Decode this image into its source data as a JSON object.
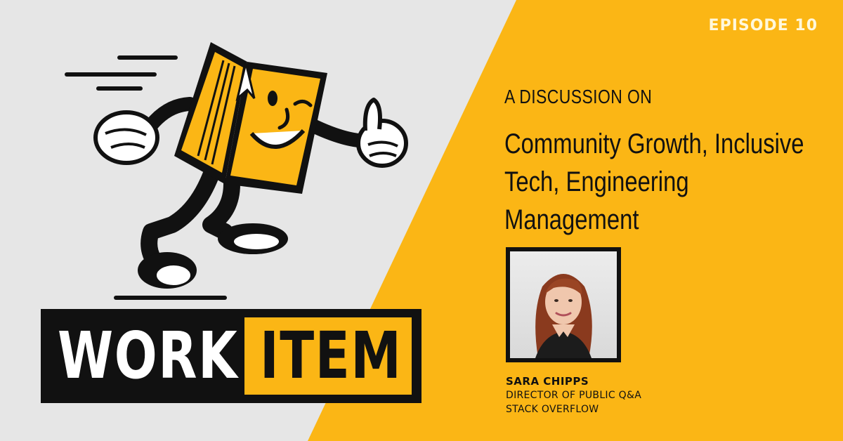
{
  "episode": {
    "label": "EPISODE 10"
  },
  "headline": {
    "kicker": "A DISCUSSION ON",
    "topics": "Community Growth, Inclusive Tech, Engineering Management"
  },
  "guest": {
    "name": "SARA CHIPPS",
    "role": "DIRECTOR OF PUBLIC Q&A",
    "organization": "STACK OVERFLOW"
  },
  "logo": {
    "word1": "WORK",
    "word2": "ITEM"
  },
  "colors": {
    "accent": "#fbb615",
    "background_left": "#e6e6e6",
    "ink": "#111111"
  },
  "icons": {
    "mascot": "running-work-item-mascot-icon"
  }
}
